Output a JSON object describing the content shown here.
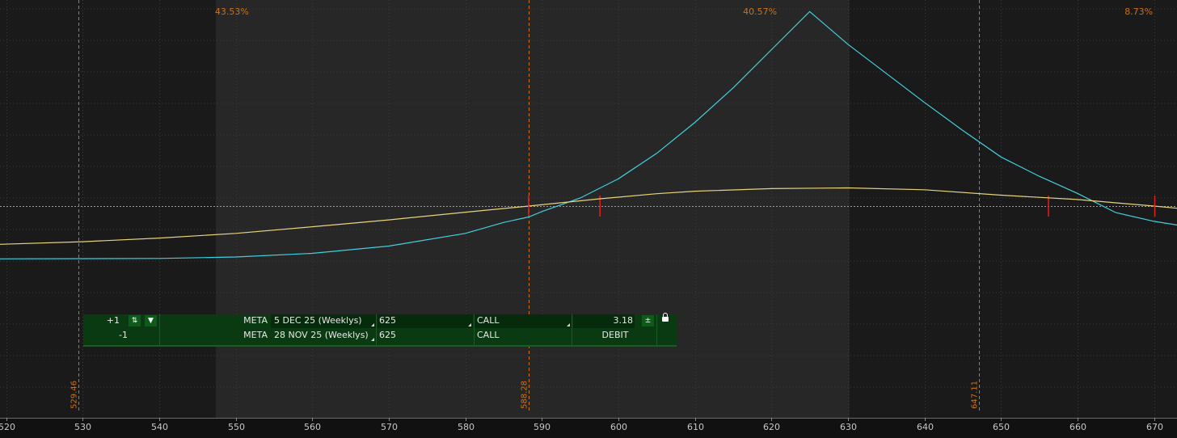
{
  "chart_data": {
    "type": "line",
    "title": "",
    "xlabel": "",
    "ylabel": "",
    "xlim": [
      519.2,
      673.0
    ],
    "x_ticks": [
      520,
      530,
      540,
      550,
      560,
      570,
      580,
      590,
      600,
      610,
      620,
      630,
      640,
      650,
      660,
      670
    ],
    "grid": true,
    "zero_line": true,
    "series": [
      {
        "color": "#40d0e0",
        "x": [
          519.2,
          540,
          550,
          560,
          570,
          580,
          585,
          588.28,
          590,
          595,
          600,
          605,
          610,
          615,
          620,
          625,
          630,
          635,
          640,
          645,
          650,
          655,
          660,
          665,
          670,
          673
        ],
        "y": [
          -1.45,
          -1.44,
          -1.4,
          -1.3,
          -1.1,
          -0.75,
          -0.45,
          -0.3,
          -0.15,
          0.22,
          0.75,
          1.45,
          2.3,
          3.25,
          4.3,
          5.35,
          4.45,
          3.65,
          2.85,
          2.08,
          1.35,
          0.82,
          0.35,
          -0.18,
          -0.42,
          -0.52
        ],
        "markers": [
          {
            "x": 597.6,
            "y": 0
          },
          {
            "x": 656.2,
            "y": 0
          }
        ]
      },
      {
        "color": "#e8d47a",
        "x": [
          519.2,
          530,
          540,
          550,
          560,
          570,
          580,
          588.28,
          597.6,
          605,
          610,
          620,
          630,
          640,
          650,
          660,
          670,
          673
        ],
        "y": [
          -1.05,
          -0.98,
          -0.88,
          -0.75,
          -0.57,
          -0.38,
          -0.17,
          0.0,
          0.2,
          0.34,
          0.41,
          0.48,
          0.5,
          0.45,
          0.3,
          0.18,
          0.0,
          -0.06
        ],
        "markers": [
          {
            "x": 588.28,
            "y": 0
          },
          {
            "x": 670.1,
            "y": 0
          }
        ]
      }
    ],
    "vertical_markers": [
      {
        "x": 529.46,
        "label": "529.46"
      },
      {
        "x": 588.28,
        "label": "588.28"
      },
      {
        "x": 647.11,
        "label": "647.11"
      }
    ],
    "shaded_zones": [
      {
        "x0": 519.2,
        "x1": 547.4,
        "shade": "dark"
      },
      {
        "x0": 547.4,
        "x1": 630.2,
        "shade": "light"
      },
      {
        "x0": 630.2,
        "x1": 673.0,
        "shade": "dark"
      }
    ],
    "probabilities": [
      {
        "x": 549.5,
        "label": "43.53%"
      },
      {
        "x": 618.5,
        "label": "40.57%"
      },
      {
        "x": 668.0,
        "label": "8.73%"
      }
    ]
  },
  "colors": {
    "background": "#1a1a1a",
    "shade_light": "#272727",
    "grid": "#3a3a3a",
    "zero_line": "#9a9a9a",
    "marker_orange": "#d07010",
    "marker_red": "#e02020",
    "axis_text": "#c8c8c8"
  },
  "order": {
    "rows": [
      {
        "qty": "+1",
        "symbol": "META",
        "expiration": "5 DEC 25 (Weeklys)",
        "strike": "625",
        "type": "CALL",
        "price": "3.18"
      },
      {
        "qty": "-1",
        "symbol": "META",
        "expiration": "28 NOV 25 (Weeklys)",
        "strike": "625",
        "type": "CALL",
        "price": "DEBIT"
      }
    ]
  },
  "icons": {
    "qty_stepper": "up-down-stepper-icon",
    "dropdown": "triangle-down-icon",
    "price_stepper": "plus-minus-stepper-icon",
    "lock": "lock-icon"
  }
}
